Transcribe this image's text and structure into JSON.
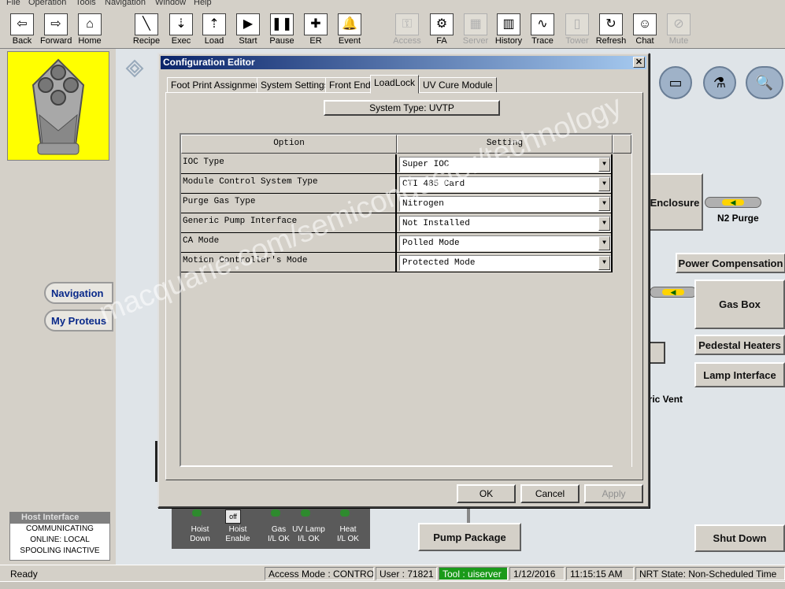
{
  "menu": [
    "File",
    "Operation",
    "Tools",
    "Navigation",
    "Window",
    "Help"
  ],
  "toolbar": [
    {
      "label": "Back",
      "glyph": "⇦",
      "enabled": true
    },
    {
      "label": "Forward",
      "glyph": "⇨",
      "enabled": true
    },
    {
      "label": "Home",
      "glyph": "⌂",
      "enabled": true
    },
    {
      "label": "Recipe",
      "glyph": "╲",
      "enabled": true
    },
    {
      "label": "Exec",
      "glyph": "⇣",
      "enabled": true
    },
    {
      "label": "Load",
      "glyph": "⇡",
      "enabled": true
    },
    {
      "label": "Start",
      "glyph": "▶",
      "enabled": true
    },
    {
      "label": "Pause",
      "glyph": "❚❚",
      "enabled": true
    },
    {
      "label": "ER",
      "glyph": "✚",
      "enabled": true
    },
    {
      "label": "Event",
      "glyph": "🔔",
      "enabled": true
    },
    {
      "label": "Access",
      "glyph": "⚿",
      "enabled": false
    },
    {
      "label": "FA",
      "glyph": "⚙",
      "enabled": true
    },
    {
      "label": "Server",
      "glyph": "▦",
      "enabled": false
    },
    {
      "label": "History",
      "glyph": "▥",
      "enabled": true
    },
    {
      "label": "Trace",
      "glyph": "∿",
      "enabled": true
    },
    {
      "label": "Tower",
      "glyph": "▯",
      "enabled": false
    },
    {
      "label": "Refresh",
      "glyph": "↻",
      "enabled": true
    },
    {
      "label": "Chat",
      "glyph": "☺",
      "enabled": true
    },
    {
      "label": "Mute",
      "glyph": "⊘",
      "enabled": false
    }
  ],
  "left": {
    "nav_label": "Navigation",
    "proteus_label": "My Proteus",
    "host": {
      "title": "Host Interface",
      "lines": [
        "COMMUNICATING",
        "ONLINE: LOCAL",
        "SPOOLING INACTIVE"
      ]
    }
  },
  "main": {
    "enclosure": "Enclosure",
    "n2_purge": "N2 Purge",
    "power_comp": "Power Compensation",
    "gas_box": "Gas Box",
    "pedestal": "Pedestal Heaters",
    "lamp": "Lamp Interface",
    "generic_vent": "eric Vent",
    "pump_package": "Pump Package",
    "shut_down": "Shut Down",
    "interlocks": [
      {
        "label": "Hoist\nDown"
      },
      {
        "label": "Hoist\nEnable",
        "off": "off"
      },
      {
        "label": "Gas\nI/L OK"
      },
      {
        "label": "UV Lamp\nI/L OK"
      },
      {
        "label": "Heat\nI/L OK"
      }
    ]
  },
  "dialog": {
    "title": "Configuration Editor",
    "close": "✕",
    "tabs": [
      "Foot Print Assignment",
      "System Settings",
      "Front End",
      "LoadLock",
      "UV Cure Module"
    ],
    "active_tab": "LoadLock",
    "system_type": "System Type: UVTP",
    "grid_headers": [
      "Option",
      "Setting"
    ],
    "rows": [
      {
        "option": "IOC Type",
        "setting": "Super IOC"
      },
      {
        "option": "Module Control System Type",
        "setting": "CTI 485 Card"
      },
      {
        "option": "Purge Gas Type",
        "setting": "Nitrogen"
      },
      {
        "option": "Generic Pump Interface",
        "setting": "Not Installed"
      },
      {
        "option": "CA Mode",
        "setting": "Polled Mode"
      },
      {
        "option": "Motion Controller's Mode",
        "setting": "Protected Mode"
      }
    ],
    "ok": "OK",
    "cancel": "Cancel",
    "apply": "Apply"
  },
  "status": {
    "ready": "Ready",
    "access": "Access Mode : CONTROL",
    "user": "User :  71821",
    "tool": "Tool :  uiserver",
    "date": "1/12/2016",
    "time": "11:15:15 AM",
    "nrt": "NRT State: Non-Scheduled Time"
  },
  "watermark": "macquarie.com/semiconductor/technology",
  "colors": {
    "tool_status": "#1a9a1a",
    "title_bar": "#0a246a",
    "logo_bg": "#ffff00"
  }
}
